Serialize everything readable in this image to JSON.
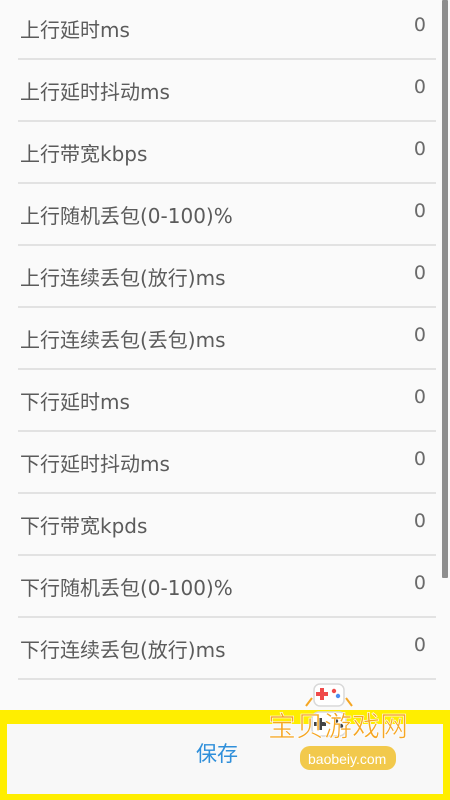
{
  "settings": [
    {
      "label": "上行延时ms",
      "value": "0"
    },
    {
      "label": "上行延时抖动ms",
      "value": "0"
    },
    {
      "label": "上行带宽kbps",
      "value": "0"
    },
    {
      "label": "上行随机丢包(0-100)%",
      "value": "0"
    },
    {
      "label": "上行连续丢包(放行)ms",
      "value": "0"
    },
    {
      "label": "上行连续丢包(丢包)ms",
      "value": "0"
    },
    {
      "label": "下行延时ms",
      "value": "0"
    },
    {
      "label": "下行延时抖动ms",
      "value": "0"
    },
    {
      "label": "下行带宽kpds",
      "value": "0"
    },
    {
      "label": "下行随机丢包(0-100)%",
      "value": "0"
    },
    {
      "label": "下行连续丢包(放行)ms",
      "value": "0"
    }
  ],
  "save_label": "保存",
  "watermark": {
    "title": "宝贝游戏网",
    "url": "baobeiy.com"
  },
  "colors": {
    "accent": "#2f8fda",
    "frame": "#ffee00",
    "text": "#5b5b5b",
    "watermark": "#f5a623"
  }
}
